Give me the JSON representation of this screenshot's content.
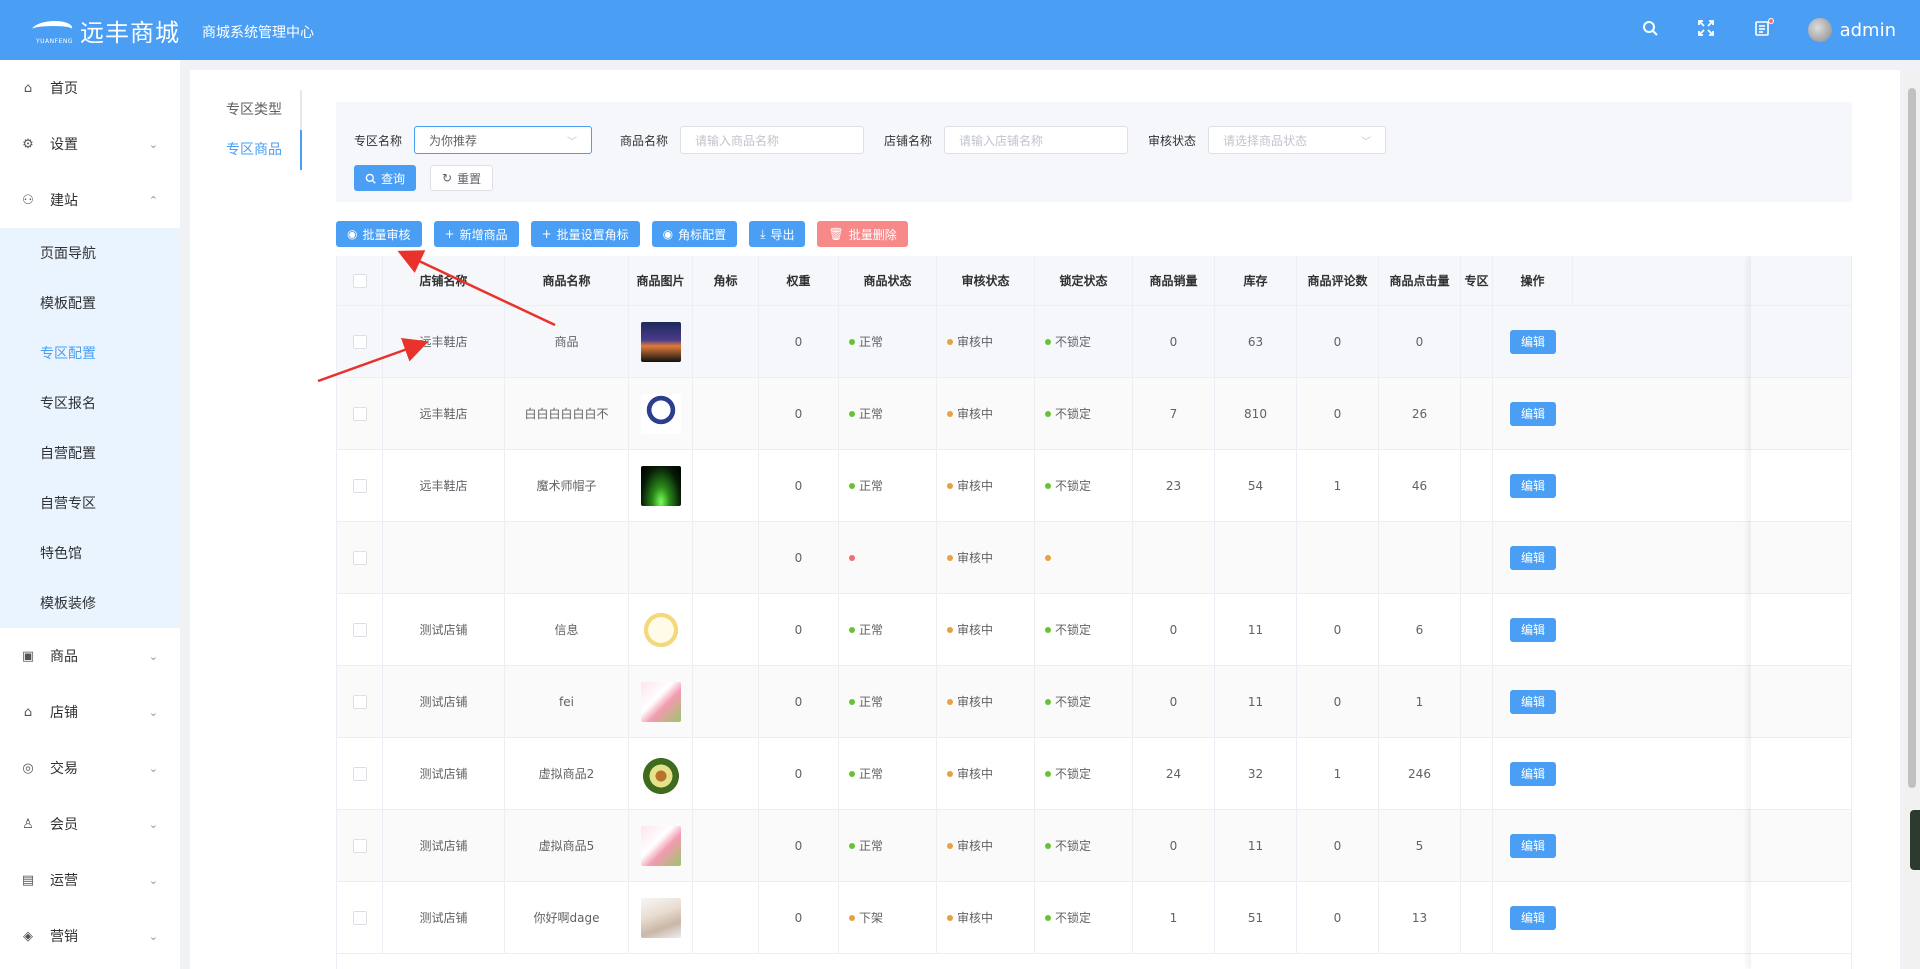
{
  "header": {
    "brand": "远丰商城",
    "brand_sub": "YUANFENG",
    "system_title": "商城系统管理中心",
    "user_name": "admin"
  },
  "sidebar": {
    "items": [
      {
        "label": "首页",
        "icon": "home-icon",
        "glyph": "⌂",
        "expandable": false
      },
      {
        "label": "设置",
        "icon": "gear-icon",
        "glyph": "⚙",
        "expandable": true,
        "chevron": "⌄"
      },
      {
        "label": "建站",
        "icon": "site-icon",
        "glyph": "⚇",
        "expandable": true,
        "chevron": "⌃"
      }
    ],
    "sub_items": [
      {
        "label": "页面导航",
        "active": false
      },
      {
        "label": "模板配置",
        "active": false
      },
      {
        "label": "专区配置",
        "active": true
      },
      {
        "label": "专区报名",
        "active": false
      },
      {
        "label": "自营配置",
        "active": false
      },
      {
        "label": "自营专区",
        "active": false
      },
      {
        "label": "特色馆",
        "active": false
      },
      {
        "label": "模板装修",
        "active": false
      }
    ],
    "items_after": [
      {
        "label": "商品",
        "icon": "goods-icon",
        "glyph": "▣",
        "chevron": "⌄"
      },
      {
        "label": "店铺",
        "icon": "store-icon",
        "glyph": "⌂",
        "chevron": "⌄"
      },
      {
        "label": "交易",
        "icon": "trade-icon",
        "glyph": "◎",
        "chevron": "⌄"
      },
      {
        "label": "会员",
        "icon": "member-icon",
        "glyph": "♙",
        "chevron": "⌄"
      },
      {
        "label": "运营",
        "icon": "operation-icon",
        "glyph": "▤",
        "chevron": "⌄"
      },
      {
        "label": "营销",
        "icon": "marketing-icon",
        "glyph": "◈",
        "chevron": "⌄"
      }
    ]
  },
  "tabs": [
    {
      "label": "专区类型",
      "active": false
    },
    {
      "label": "专区商品",
      "active": true
    }
  ],
  "filter": {
    "zone_label": "专区名称",
    "zone_value": "为你推荐",
    "goods_label": "商品名称",
    "goods_placeholder": "请输入商品名称",
    "store_label": "店铺名称",
    "store_placeholder": "请输入店铺名称",
    "audit_label": "审核状态",
    "audit_placeholder": "请选择商品状态",
    "search_btn": "查询",
    "reset_btn": "重置"
  },
  "actions": {
    "batch_audit": "批量审核",
    "add_goods": "新增商品",
    "batch_corner": "批量设置角标",
    "corner_config": "角标配置",
    "export": "导出",
    "batch_delete": "批量删除"
  },
  "table": {
    "headers": [
      "",
      "店铺名称",
      "商品名称",
      "商品图片",
      "角标",
      "权重",
      "商品状态",
      "审核状态",
      "锁定状态",
      "商品销量",
      "库存",
      "商品评论数",
      "商品点击量",
      "专区",
      "操作"
    ],
    "edit_label": "编辑",
    "rows": [
      {
        "store": "远丰鞋店",
        "name": "商品",
        "thumb": "city-night",
        "corner": "",
        "weight": "0",
        "status": "正常",
        "status_color": "#67c23a",
        "audit": "审核中",
        "audit_color": "#e6a23c",
        "lock": "不锁定",
        "lock_color": "#67c23a",
        "sales": "0",
        "stock": "63",
        "comments": "0",
        "clicks": "0"
      },
      {
        "store": "远丰鞋店",
        "name": "白白白白白白不",
        "thumb": "cartoon",
        "corner": "",
        "weight": "0",
        "status": "正常",
        "status_color": "#67c23a",
        "audit": "审核中",
        "audit_color": "#e6a23c",
        "lock": "不锁定",
        "lock_color": "#67c23a",
        "sales": "7",
        "stock": "810",
        "comments": "0",
        "clicks": "26"
      },
      {
        "store": "远丰鞋店",
        "name": "魔术师帽子",
        "thumb": "green-light",
        "corner": "",
        "weight": "0",
        "status": "正常",
        "status_color": "#67c23a",
        "audit": "审核中",
        "audit_color": "#e6a23c",
        "lock": "不锁定",
        "lock_color": "#67c23a",
        "sales": "23",
        "stock": "54",
        "comments": "1",
        "clicks": "46"
      },
      {
        "store": "",
        "name": "",
        "thumb": "",
        "corner": "",
        "weight": "0",
        "status": "",
        "status_color": "#f56c6c",
        "audit": "审核中",
        "audit_color": "#e6a23c",
        "lock": "",
        "lock_color": "#e6a23c",
        "sales": "",
        "stock": "",
        "comments": "",
        "clicks": ""
      },
      {
        "store": "测试店铺",
        "name": "信息",
        "thumb": "rice",
        "corner": "",
        "weight": "0",
        "status": "正常",
        "status_color": "#67c23a",
        "audit": "审核中",
        "audit_color": "#e6a23c",
        "lock": "不锁定",
        "lock_color": "#67c23a",
        "sales": "0",
        "stock": "11",
        "comments": "0",
        "clicks": "6"
      },
      {
        "store": "测试店铺",
        "name": "fei",
        "thumb": "food-pink",
        "corner": "",
        "weight": "0",
        "status": "正常",
        "status_color": "#67c23a",
        "audit": "审核中",
        "audit_color": "#e6a23c",
        "lock": "不锁定",
        "lock_color": "#67c23a",
        "sales": "0",
        "stock": "11",
        "comments": "0",
        "clicks": "1"
      },
      {
        "store": "测试店铺",
        "name": "虚拟商品2",
        "thumb": "avocado",
        "corner": "",
        "weight": "0",
        "status": "正常",
        "status_color": "#67c23a",
        "audit": "审核中",
        "audit_color": "#e6a23c",
        "lock": "不锁定",
        "lock_color": "#67c23a",
        "sales": "24",
        "stock": "32",
        "comments": "1",
        "clicks": "246"
      },
      {
        "store": "测试店铺",
        "name": "虚拟商品5",
        "thumb": "food-pink",
        "corner": "",
        "weight": "0",
        "status": "正常",
        "status_color": "#67c23a",
        "audit": "审核中",
        "audit_color": "#e6a23c",
        "lock": "不锁定",
        "lock_color": "#67c23a",
        "sales": "0",
        "stock": "11",
        "comments": "0",
        "clicks": "5"
      },
      {
        "store": "测试店铺",
        "name": "你好啊dage",
        "thumb": "dancer",
        "corner": "",
        "weight": "0",
        "status": "下架",
        "status_color": "#e6a23c",
        "audit": "审核中",
        "audit_color": "#e6a23c",
        "lock": "不锁定",
        "lock_color": "#67c23a",
        "sales": "1",
        "stock": "51",
        "comments": "0",
        "clicks": "13"
      }
    ]
  }
}
